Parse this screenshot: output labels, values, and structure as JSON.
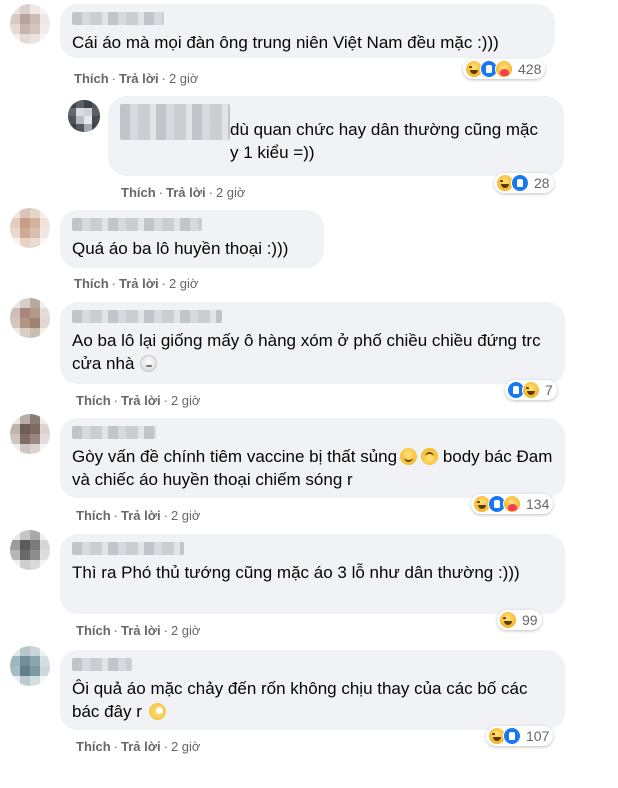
{
  "labels": {
    "like": "Thích",
    "reply": "Trả lời",
    "sep": "·"
  },
  "comments": [
    {
      "text": "Cái áo mà mọi đàn ông trung niên Việt Nam đều mặc :)))",
      "time": "2 giờ",
      "reactions": [
        "haha-icon",
        "like-icon",
        "care-icon"
      ],
      "count": "428"
    },
    {
      "text": "dù quan chức hay dân thường cũng mặc y 1 kiểu =))",
      "time": "2 giờ",
      "reactions": [
        "haha-icon",
        "like-icon"
      ],
      "count": "28",
      "reply": true
    },
    {
      "text": "Quá áo ba lô huyền thoại :)))",
      "time": "2 giờ",
      "reactions": [],
      "count": ""
    },
    {
      "text": "Ao ba lô lại giống mấy ô hàng xóm ở phố chiều chiều đứng trc cửa nhà",
      "time": "2 giờ",
      "reactions": [
        "like-icon",
        "haha-icon"
      ],
      "count": "7"
    },
    {
      "text": "Gòy vấn đề chính tiêm vaccine bị thất sủng",
      "text2": "body bác Đam và chiếc áo huyền thoại chiếm sóng r",
      "time": "2 giờ",
      "reactions": [
        "haha-icon",
        "like-icon",
        "care-icon"
      ],
      "count": "134"
    },
    {
      "text": "Thì ra Phó thủ tướng cũng mặc áo 3 lỗ như dân thường :)))",
      "time": "2 giờ",
      "reactions": [
        "haha-icon"
      ],
      "count": "99"
    },
    {
      "text": "Ôi quả áo mặc chảy đến rốn không chịu thay của các bố các bác đây r",
      "time": "2 giờ",
      "reactions": [
        "haha-icon",
        "like-icon"
      ],
      "count": "107"
    }
  ],
  "colors": {
    "bubble": "#f0f2f5",
    "meta": "#65676b",
    "text": "#050505",
    "like": "#1877f2",
    "haha": "#f7b125"
  }
}
